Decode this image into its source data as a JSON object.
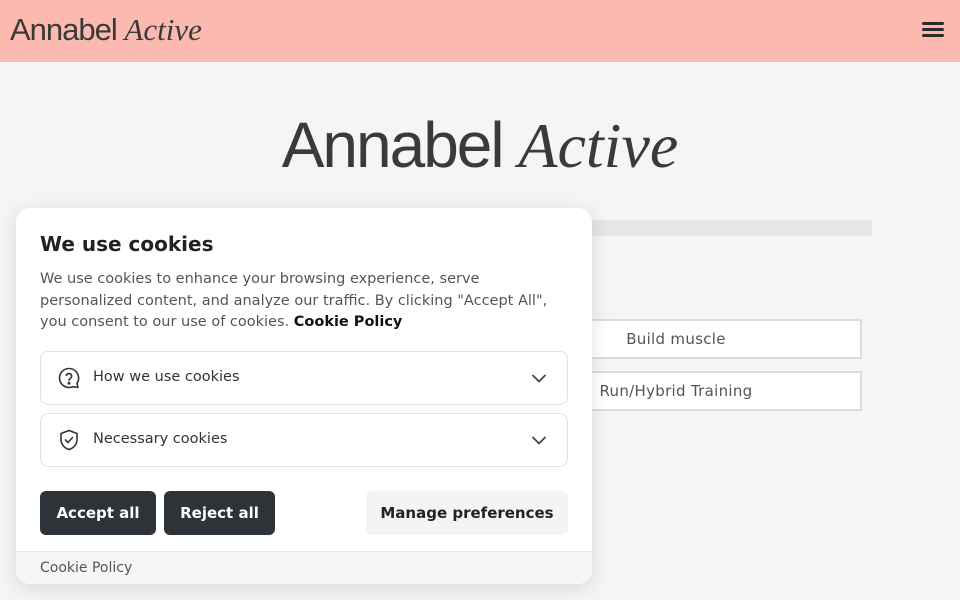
{
  "header": {
    "brand_regular": "Annabel",
    "brand_italic": "Active",
    "menu_icon": "hamburger-icon"
  },
  "hero": {
    "brand_regular": "Annabel",
    "brand_italic": "Active"
  },
  "quiz": {
    "progress": 0,
    "options": [
      "Build muscle",
      "Run/Hybrid Training"
    ]
  },
  "cookie_banner": {
    "title": "We use cookies",
    "description": "We use cookies to enhance your browsing experience, serve personalized content, and analyze our traffic. By clicking \"Accept All\", you consent to our use of cookies.",
    "policy_link": "Cookie Policy",
    "sections": [
      {
        "label": "How we use cookies",
        "icon": "question-icon"
      },
      {
        "label": "Necessary cookies",
        "icon": "shield-check-icon"
      }
    ],
    "buttons": {
      "accept": "Accept all",
      "reject": "Reject all",
      "manage": "Manage preferences"
    },
    "footer_link": "Cookie Policy"
  },
  "colors": {
    "header_bg": "#fbb9b0",
    "button_dark": "#2d3338"
  }
}
